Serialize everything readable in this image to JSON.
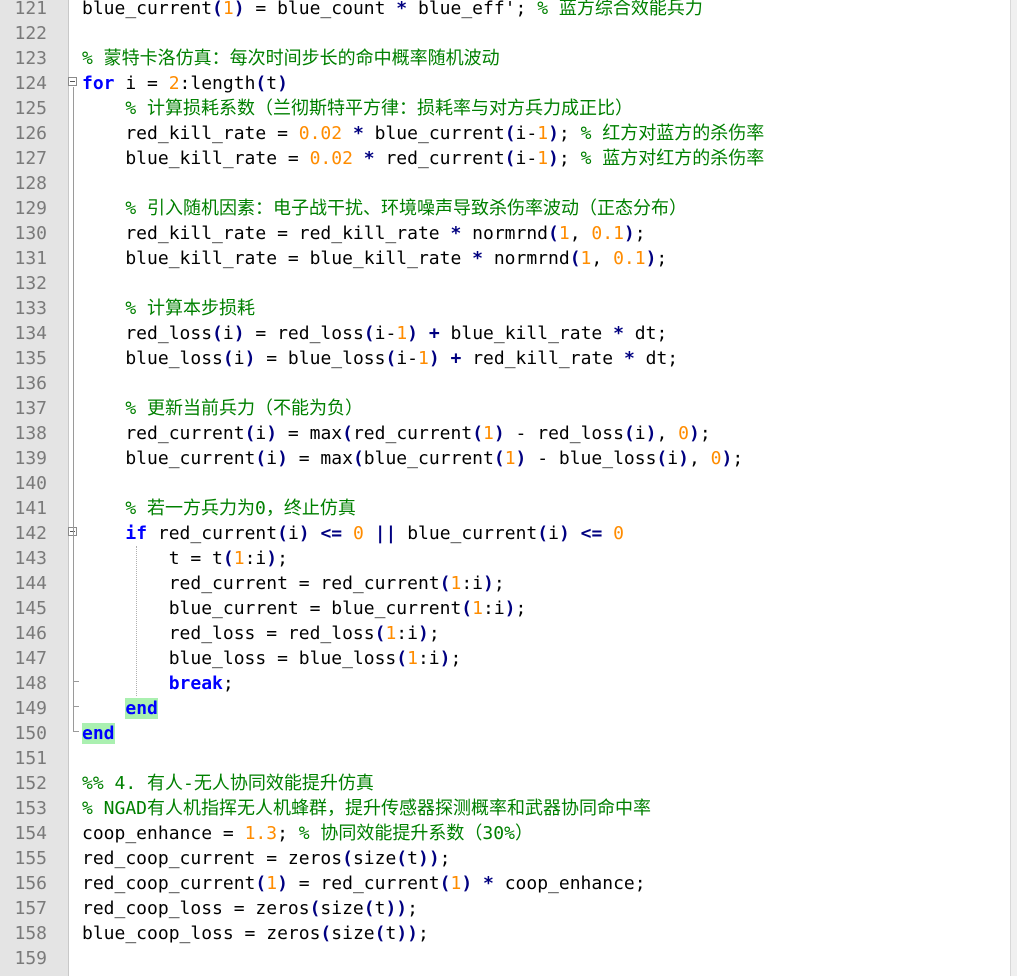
{
  "editor": {
    "lines": [
      {
        "num": "121",
        "segments": [
          {
            "t": "blue_current"
          },
          {
            "t": "(",
            "c": "o"
          },
          {
            "t": "1",
            "c": "n"
          },
          {
            "t": ")",
            "c": "o"
          },
          {
            "t": " = blue_count "
          },
          {
            "t": "*",
            "c": "o"
          },
          {
            "t": " blue_eff';"
          },
          {
            "t": " % 蓝方综合效能兵力",
            "c": "c"
          }
        ]
      },
      {
        "num": "122",
        "segments": []
      },
      {
        "num": "123",
        "segments": [
          {
            "t": "% 蒙特卡洛仿真：每次时间步长的命中概率随机波动",
            "c": "c"
          }
        ]
      },
      {
        "num": "124",
        "fold": "start",
        "segments": [
          {
            "t": "for",
            "c": "k"
          },
          {
            "t": " i = "
          },
          {
            "t": "2",
            "c": "n"
          },
          {
            "t": ":length"
          },
          {
            "t": "(",
            "c": "o"
          },
          {
            "t": "t"
          },
          {
            "t": ")",
            "c": "o"
          }
        ]
      },
      {
        "num": "125",
        "segments": [
          {
            "t": "    "
          },
          {
            "t": "% 计算损耗系数（兰彻斯特平方律：损耗率与对方兵力成正比）",
            "c": "c"
          }
        ]
      },
      {
        "num": "126",
        "segments": [
          {
            "t": "    red_kill_rate = "
          },
          {
            "t": "0.02",
            "c": "n"
          },
          {
            "t": " "
          },
          {
            "t": "*",
            "c": "o"
          },
          {
            "t": " blue_current"
          },
          {
            "t": "(",
            "c": "o"
          },
          {
            "t": "i-"
          },
          {
            "t": "1",
            "c": "n"
          },
          {
            "t": ")",
            "c": "o"
          },
          {
            "t": ";"
          },
          {
            "t": " % 红方对蓝方的杀伤率",
            "c": "c"
          }
        ]
      },
      {
        "num": "127",
        "segments": [
          {
            "t": "    blue_kill_rate = "
          },
          {
            "t": "0.02",
            "c": "n"
          },
          {
            "t": " "
          },
          {
            "t": "*",
            "c": "o"
          },
          {
            "t": " red_current"
          },
          {
            "t": "(",
            "c": "o"
          },
          {
            "t": "i-"
          },
          {
            "t": "1",
            "c": "n"
          },
          {
            "t": ")",
            "c": "o"
          },
          {
            "t": ";"
          },
          {
            "t": " % 蓝方对红方的杀伤率",
            "c": "c"
          }
        ]
      },
      {
        "num": "128",
        "segments": []
      },
      {
        "num": "129",
        "segments": [
          {
            "t": "    "
          },
          {
            "t": "% 引入随机因素：电子战干扰、环境噪声导致杀伤率波动（正态分布）",
            "c": "c"
          }
        ]
      },
      {
        "num": "130",
        "segments": [
          {
            "t": "    red_kill_rate = red_kill_rate "
          },
          {
            "t": "*",
            "c": "o"
          },
          {
            "t": " normrnd"
          },
          {
            "t": "(",
            "c": "o"
          },
          {
            "t": "1",
            "c": "n"
          },
          {
            "t": ", "
          },
          {
            "t": "0.1",
            "c": "n"
          },
          {
            "t": ")",
            "c": "o"
          },
          {
            "t": ";"
          }
        ]
      },
      {
        "num": "131",
        "segments": [
          {
            "t": "    blue_kill_rate = blue_kill_rate "
          },
          {
            "t": "*",
            "c": "o"
          },
          {
            "t": " normrnd"
          },
          {
            "t": "(",
            "c": "o"
          },
          {
            "t": "1",
            "c": "n"
          },
          {
            "t": ", "
          },
          {
            "t": "0.1",
            "c": "n"
          },
          {
            "t": ")",
            "c": "o"
          },
          {
            "t": ";"
          }
        ]
      },
      {
        "num": "132",
        "segments": []
      },
      {
        "num": "133",
        "segments": [
          {
            "t": "    "
          },
          {
            "t": "% 计算本步损耗",
            "c": "c"
          }
        ]
      },
      {
        "num": "134",
        "segments": [
          {
            "t": "    red_loss"
          },
          {
            "t": "(",
            "c": "o"
          },
          {
            "t": "i"
          },
          {
            "t": ")",
            "c": "o"
          },
          {
            "t": " = red_loss"
          },
          {
            "t": "(",
            "c": "o"
          },
          {
            "t": "i-"
          },
          {
            "t": "1",
            "c": "n"
          },
          {
            "t": ")",
            "c": "o"
          },
          {
            "t": " "
          },
          {
            "t": "+",
            "c": "o"
          },
          {
            "t": " blue_kill_rate "
          },
          {
            "t": "*",
            "c": "o"
          },
          {
            "t": " dt;"
          }
        ]
      },
      {
        "num": "135",
        "segments": [
          {
            "t": "    blue_loss"
          },
          {
            "t": "(",
            "c": "o"
          },
          {
            "t": "i"
          },
          {
            "t": ")",
            "c": "o"
          },
          {
            "t": " = blue_loss"
          },
          {
            "t": "(",
            "c": "o"
          },
          {
            "t": "i-"
          },
          {
            "t": "1",
            "c": "n"
          },
          {
            "t": ")",
            "c": "o"
          },
          {
            "t": " "
          },
          {
            "t": "+",
            "c": "o"
          },
          {
            "t": " red_kill_rate "
          },
          {
            "t": "*",
            "c": "o"
          },
          {
            "t": " dt;"
          }
        ]
      },
      {
        "num": "136",
        "segments": []
      },
      {
        "num": "137",
        "segments": [
          {
            "t": "    "
          },
          {
            "t": "% 更新当前兵力（不能为负）",
            "c": "c"
          }
        ]
      },
      {
        "num": "138",
        "segments": [
          {
            "t": "    red_current"
          },
          {
            "t": "(",
            "c": "o"
          },
          {
            "t": "i"
          },
          {
            "t": ")",
            "c": "o"
          },
          {
            "t": " = max"
          },
          {
            "t": "(",
            "c": "o"
          },
          {
            "t": "red_current"
          },
          {
            "t": "(",
            "c": "o"
          },
          {
            "t": "1",
            "c": "n"
          },
          {
            "t": ")",
            "c": "o"
          },
          {
            "t": " - red_loss"
          },
          {
            "t": "(",
            "c": "o"
          },
          {
            "t": "i"
          },
          {
            "t": ")",
            "c": "o"
          },
          {
            "t": ", "
          },
          {
            "t": "0",
            "c": "n"
          },
          {
            "t": ")",
            "c": "o"
          },
          {
            "t": ";"
          }
        ]
      },
      {
        "num": "139",
        "segments": [
          {
            "t": "    blue_current"
          },
          {
            "t": "(",
            "c": "o"
          },
          {
            "t": "i"
          },
          {
            "t": ")",
            "c": "o"
          },
          {
            "t": " = max"
          },
          {
            "t": "(",
            "c": "o"
          },
          {
            "t": "blue_current"
          },
          {
            "t": "(",
            "c": "o"
          },
          {
            "t": "1",
            "c": "n"
          },
          {
            "t": ")",
            "c": "o"
          },
          {
            "t": " - blue_loss"
          },
          {
            "t": "(",
            "c": "o"
          },
          {
            "t": "i"
          },
          {
            "t": ")",
            "c": "o"
          },
          {
            "t": ", "
          },
          {
            "t": "0",
            "c": "n"
          },
          {
            "t": ")",
            "c": "o"
          },
          {
            "t": ";"
          }
        ]
      },
      {
        "num": "140",
        "segments": []
      },
      {
        "num": "141",
        "segments": [
          {
            "t": "    "
          },
          {
            "t": "% 若一方兵力为0，终止仿真",
            "c": "c"
          }
        ]
      },
      {
        "num": "142",
        "fold": "start",
        "segments": [
          {
            "t": "    "
          },
          {
            "t": "if",
            "c": "k"
          },
          {
            "t": " red_current"
          },
          {
            "t": "(",
            "c": "o"
          },
          {
            "t": "i"
          },
          {
            "t": ")",
            "c": "o"
          },
          {
            "t": " "
          },
          {
            "t": "<=",
            "c": "o"
          },
          {
            "t": " "
          },
          {
            "t": "0",
            "c": "n"
          },
          {
            "t": " "
          },
          {
            "t": "||",
            "c": "o"
          },
          {
            "t": " blue_current"
          },
          {
            "t": "(",
            "c": "o"
          },
          {
            "t": "i"
          },
          {
            "t": ")",
            "c": "o"
          },
          {
            "t": " "
          },
          {
            "t": "<=",
            "c": "o"
          },
          {
            "t": " "
          },
          {
            "t": "0",
            "c": "n"
          }
        ]
      },
      {
        "num": "143",
        "segments": [
          {
            "t": "        t = t"
          },
          {
            "t": "(",
            "c": "o"
          },
          {
            "t": "1",
            "c": "n"
          },
          {
            "t": ":i"
          },
          {
            "t": ")",
            "c": "o"
          },
          {
            "t": ";"
          }
        ]
      },
      {
        "num": "144",
        "segments": [
          {
            "t": "        red_current = red_current"
          },
          {
            "t": "(",
            "c": "o"
          },
          {
            "t": "1",
            "c": "n"
          },
          {
            "t": ":i"
          },
          {
            "t": ")",
            "c": "o"
          },
          {
            "t": ";"
          }
        ]
      },
      {
        "num": "145",
        "segments": [
          {
            "t": "        blue_current = blue_current"
          },
          {
            "t": "(",
            "c": "o"
          },
          {
            "t": "1",
            "c": "n"
          },
          {
            "t": ":i"
          },
          {
            "t": ")",
            "c": "o"
          },
          {
            "t": ";"
          }
        ]
      },
      {
        "num": "146",
        "segments": [
          {
            "t": "        red_loss = red_loss"
          },
          {
            "t": "(",
            "c": "o"
          },
          {
            "t": "1",
            "c": "n"
          },
          {
            "t": ":i"
          },
          {
            "t": ")",
            "c": "o"
          },
          {
            "t": ";"
          }
        ]
      },
      {
        "num": "147",
        "segments": [
          {
            "t": "        blue_loss = blue_loss"
          },
          {
            "t": "(",
            "c": "o"
          },
          {
            "t": "1",
            "c": "n"
          },
          {
            "t": ":i"
          },
          {
            "t": ")",
            "c": "o"
          },
          {
            "t": ";"
          }
        ]
      },
      {
        "num": "148",
        "segments": [
          {
            "t": "        "
          },
          {
            "t": "break",
            "c": "k"
          },
          {
            "t": ";"
          }
        ]
      },
      {
        "num": "149",
        "fold": "end",
        "segments": [
          {
            "t": "    "
          },
          {
            "t": "end",
            "c": "k hl"
          }
        ]
      },
      {
        "num": "150",
        "fold": "end",
        "segments": [
          {
            "t": "end",
            "c": "k hl"
          }
        ]
      },
      {
        "num": "151",
        "segments": []
      },
      {
        "num": "152",
        "segments": [
          {
            "t": "%% 4. 有人-无人协同效能提升仿真",
            "c": "c"
          }
        ]
      },
      {
        "num": "153",
        "segments": [
          {
            "t": "% NGAD有人机指挥无人机蜂群，提升传感器探测概率和武器协同命中率",
            "c": "c"
          }
        ]
      },
      {
        "num": "154",
        "segments": [
          {
            "t": "coop_enhance = "
          },
          {
            "t": "1.3",
            "c": "n"
          },
          {
            "t": ";"
          },
          {
            "t": " % 协同效能提升系数（30%）",
            "c": "c"
          }
        ]
      },
      {
        "num": "155",
        "segments": [
          {
            "t": "red_coop_current = zeros"
          },
          {
            "t": "(",
            "c": "o"
          },
          {
            "t": "size"
          },
          {
            "t": "(",
            "c": "o"
          },
          {
            "t": "t"
          },
          {
            "t": "))",
            "c": "o"
          },
          {
            "t": ";"
          }
        ]
      },
      {
        "num": "156",
        "segments": [
          {
            "t": "red_coop_current"
          },
          {
            "t": "(",
            "c": "o"
          },
          {
            "t": "1",
            "c": "n"
          },
          {
            "t": ")",
            "c": "o"
          },
          {
            "t": " = red_current"
          },
          {
            "t": "(",
            "c": "o"
          },
          {
            "t": "1",
            "c": "n"
          },
          {
            "t": ")",
            "c": "o"
          },
          {
            "t": " "
          },
          {
            "t": "*",
            "c": "o"
          },
          {
            "t": " coop_enhance;"
          }
        ]
      },
      {
        "num": "157",
        "segments": [
          {
            "t": "red_coop_loss = zeros"
          },
          {
            "t": "(",
            "c": "o"
          },
          {
            "t": "size"
          },
          {
            "t": "(",
            "c": "o"
          },
          {
            "t": "t"
          },
          {
            "t": "))",
            "c": "o"
          },
          {
            "t": ";"
          }
        ]
      },
      {
        "num": "158",
        "segments": [
          {
            "t": "blue_coop_loss = zeros"
          },
          {
            "t": "(",
            "c": "o"
          },
          {
            "t": "size"
          },
          {
            "t": "(",
            "c": "o"
          },
          {
            "t": "t"
          },
          {
            "t": "))",
            "c": "o"
          },
          {
            "t": ";"
          }
        ]
      },
      {
        "num": "159",
        "segments": []
      }
    ]
  }
}
